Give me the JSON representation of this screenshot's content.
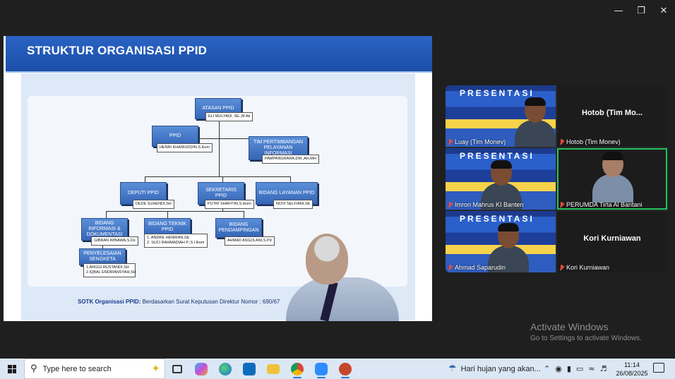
{
  "slide": {
    "title": "STRUKTUR ORGANISASI PPID",
    "caption_bold": "SOTK Organisasi PPID:",
    "caption_rest": " Berdasarkan Surat Keputusan Direktur Nomor : 690/67",
    "org": {
      "atasan": {
        "title": "ATASAN PPID",
        "name": "ELI MULYADI, SE.,M.Ak"
      },
      "ppid": {
        "title": "PPID",
        "name": "HENRI KHAIRUDDIN,S.Kom"
      },
      "tim": {
        "title": "TIM PERTIMBANGAN PELAYANAN INFORMASI",
        "name": "PAMPANGRARA,DM.,AH,MH"
      },
      "deputi": {
        "title": "DEPUTI PPID",
        "name": "DEDE SUHENDI,SH"
      },
      "sekretaris": {
        "title": "SEKRETARIS PPID",
        "name": "PUTRI SHAFITRI,S.Ikom"
      },
      "layanan": {
        "title": "BIDANG LAYANAN PPID",
        "name": "NOVI SELFIANI,SE"
      },
      "informasi": {
        "title": "BIDANG INFORMASI & DOKUMENTASI",
        "name": "GIBRAN WIBAWA,S.Ds"
      },
      "teknik": {
        "title": "BIDANG TEKNIK PPID",
        "name1": "1. ANDRE HENRIAN,SE",
        "name2": "2. SUCI RAHMADIAH P.,S.I.Ikom"
      },
      "pendampingan": {
        "title": "BIDANG PENDAMPINGAN",
        "name": "AHMAD ASGOLANI,S.Pd"
      },
      "sengketa": {
        "title": "PENYELESAIAN SENGKETA",
        "name1": "1.ANGGI RUSTANDI,SH",
        "name2": "2.IQBAL ENDRIANSYAH,SH"
      }
    }
  },
  "participants": [
    {
      "name": "Luay (Tim Monev)",
      "video": true
    },
    {
      "name": "Hotob (Tim Monev)",
      "center": "Hotob  (Tim Mo...",
      "video": false
    },
    {
      "name": "Imron Mahrus KI Banten",
      "video": true
    },
    {
      "name": "PERUMDA Tirta Al Bantani",
      "video": true,
      "selected": true
    },
    {
      "name": "Ahmad Saparudin",
      "video": true
    },
    {
      "name": "Kori Kurniawan",
      "center": "Kori Kurniawan",
      "video": false
    }
  ],
  "banner_text": "PRESENTASI",
  "activate": {
    "line1": "Activate Windows",
    "line2": "Go to Settings to activate Windows."
  },
  "taskbar": {
    "search_placeholder": "Type here to search",
    "weather": "Hari hujan yang akan...",
    "time": "11:14",
    "date": "26/08/2025"
  },
  "colors": {
    "slide_header": "#1c4fa8",
    "selected_tile": "#21c25e",
    "taskbar": "#dbe7f4"
  }
}
